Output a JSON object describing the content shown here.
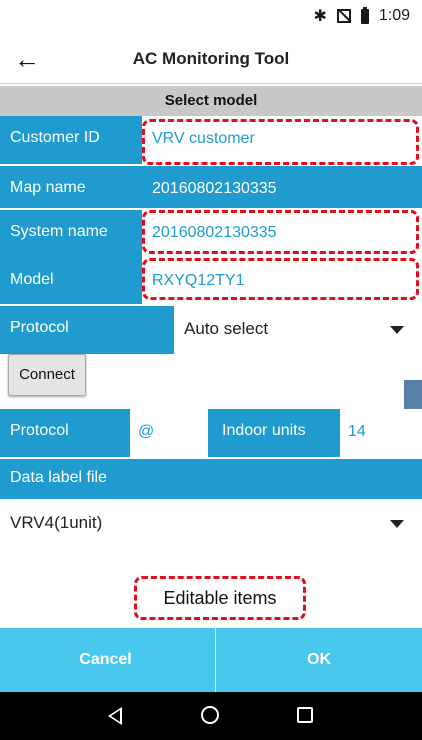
{
  "status_bar": {
    "time": "1:09",
    "bluetooth_icon": "bluetooth-icon",
    "signal_icon": "no-signal-icon",
    "battery_icon": "battery-icon"
  },
  "app_bar": {
    "back_icon": "arrow-left-icon",
    "title": "AC Monitoring Tool"
  },
  "section_header": "Select model",
  "form": {
    "customer_id": {
      "label": "Customer ID",
      "value": "VRV customer"
    },
    "map_name": {
      "label": "Map name",
      "value": "20160802130335"
    },
    "system_name": {
      "label": "System name",
      "value": "20160802130335"
    },
    "model": {
      "label": "Model",
      "value": "RXYQ12TY1"
    },
    "protocol_select": {
      "label": "Protocol",
      "value": "Auto select"
    }
  },
  "connect_button": "Connect",
  "info_row": {
    "protocol_label": "Protocol",
    "protocol_value": "@",
    "indoor_units_label": "Indoor units",
    "indoor_units_value": "14"
  },
  "data_label": {
    "label": "Data label file",
    "value": "VRV4(1unit)"
  },
  "annotation": "Editable items",
  "buttons": {
    "cancel": "Cancel",
    "ok": "OK"
  },
  "nav": {
    "back": "nav-back-icon",
    "home": "nav-home-icon",
    "recents": "nav-recents-icon"
  },
  "colors": {
    "accent": "#1f9bcf",
    "button_bar": "#49c8ee",
    "highlight": "#e10c1c",
    "header": "#c8c8c8"
  }
}
